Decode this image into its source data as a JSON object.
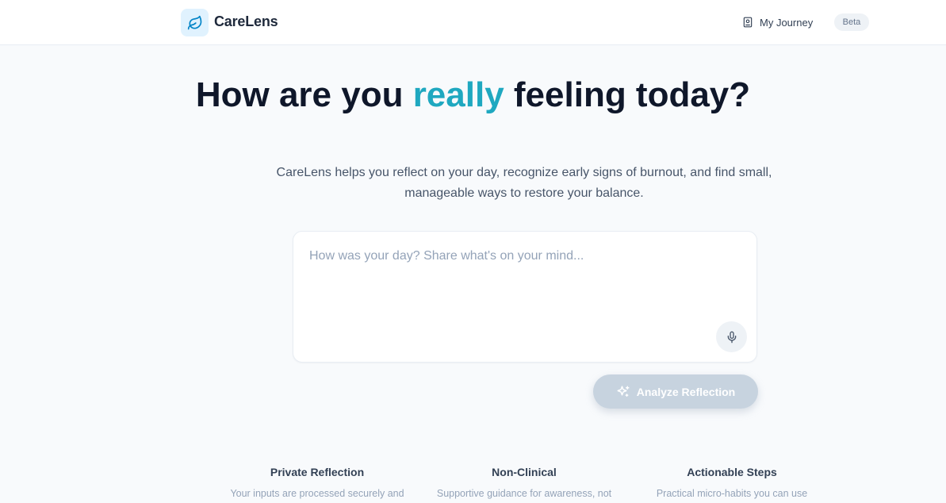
{
  "header": {
    "logo_icon": "leaf-icon",
    "brand": "CareLens",
    "journey_label": "My Journey",
    "journey_icon": "journal-icon",
    "badge": "Beta"
  },
  "hero": {
    "title_before": "How are you ",
    "title_accent": "really",
    "title_after": " feeling today?",
    "subtitle": "CareLens helps you reflect on your day, recognize early signs of burnout, and find small, manageable ways to restore your balance."
  },
  "reflection": {
    "placeholder": "How was your day? Share what's on your mind...",
    "value": "",
    "mic_icon": "microphone-icon",
    "analyze_label": "Analyze Reflection",
    "analyze_icon": "sparkles-icon"
  },
  "features": [
    {
      "title": "Private Reflection",
      "desc": "Your inputs are processed securely and"
    },
    {
      "title": "Non-Clinical",
      "desc": "Supportive guidance for awareness, not"
    },
    {
      "title": "Actionable Steps",
      "desc": "Practical micro-habits you can use"
    }
  ],
  "colors": {
    "accent": "#1fa8c0",
    "button_disabled": "#c7d3df",
    "background": "#f8fafc"
  }
}
